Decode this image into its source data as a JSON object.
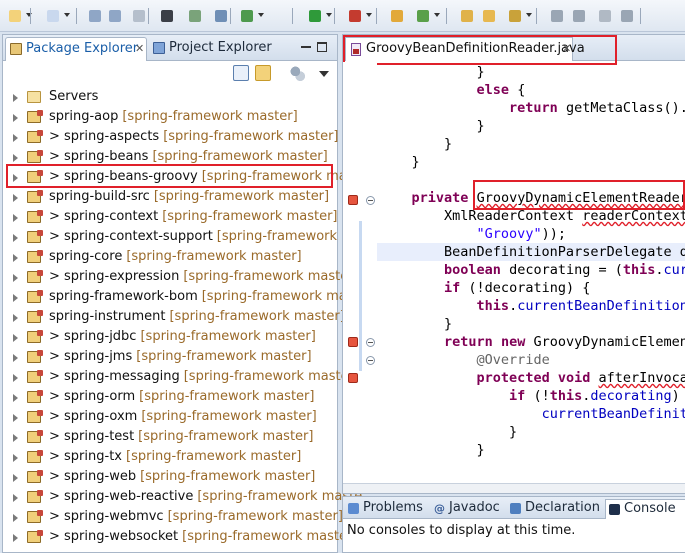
{
  "toolbar": {
    "buttons": [
      "new-icon",
      "new-wizard-icon",
      "save-icon",
      "save-all-icon",
      "print-icon",
      "console-icon",
      "open-type-icon",
      "refresh-icon",
      "run-debug-icon",
      "run-icon",
      "external-tools-icon",
      "new-java-project-icon",
      "new-class-icon",
      "open-folder-icon",
      "open-task-icon",
      "search-icon",
      "prev-annotation-icon",
      "next-annotation-icon",
      "toggle-mark-icon",
      "paragraph-icon"
    ]
  },
  "left_panel": {
    "tabs": [
      {
        "label": "Package Explorer",
        "active": true
      },
      {
        "label": "Project Explorer",
        "active": false
      }
    ],
    "tree": [
      {
        "name": "Servers",
        "repo": "",
        "prefix": "",
        "kind": "folder"
      },
      {
        "name": "spring-aop",
        "repo": "[spring-framework master]",
        "prefix": "",
        "kind": "project"
      },
      {
        "name": "spring-aspects",
        "repo": "[spring-framework master]",
        "prefix": "> ",
        "kind": "project"
      },
      {
        "name": "spring-beans",
        "repo": "[spring-framework master]",
        "prefix": "> ",
        "kind": "project"
      },
      {
        "name": "spring-beans-groovy",
        "repo": "[spring-framework mast",
        "prefix": "> ",
        "kind": "project"
      },
      {
        "name": "spring-build-src",
        "repo": "[spring-framework master]",
        "prefix": "",
        "kind": "project"
      },
      {
        "name": "spring-context",
        "repo": "[spring-framework master]",
        "prefix": "> ",
        "kind": "project"
      },
      {
        "name": "spring-context-support",
        "repo": "[spring-framework ma",
        "prefix": "> ",
        "kind": "project"
      },
      {
        "name": "spring-core",
        "repo": "[spring-framework master]",
        "prefix": "",
        "kind": "project"
      },
      {
        "name": "spring-expression",
        "repo": "[spring-framework master]",
        "prefix": "> ",
        "kind": "project"
      },
      {
        "name": "spring-framework-bom",
        "repo": "[spring-framework mast",
        "prefix": "",
        "kind": "project"
      },
      {
        "name": "spring-instrument",
        "repo": "[spring-framework master]",
        "prefix": "",
        "kind": "project"
      },
      {
        "name": "spring-jdbc",
        "repo": "[spring-framework master]",
        "prefix": "> ",
        "kind": "project"
      },
      {
        "name": "spring-jms",
        "repo": "[spring-framework master]",
        "prefix": "> ",
        "kind": "project"
      },
      {
        "name": "spring-messaging",
        "repo": "[spring-framework master]",
        "prefix": "> ",
        "kind": "project"
      },
      {
        "name": "spring-orm",
        "repo": "[spring-framework master]",
        "prefix": "> ",
        "kind": "project"
      },
      {
        "name": "spring-oxm",
        "repo": "[spring-framework master]",
        "prefix": "> ",
        "kind": "project"
      },
      {
        "name": "spring-test",
        "repo": "[spring-framework master]",
        "prefix": "> ",
        "kind": "project"
      },
      {
        "name": "spring-tx",
        "repo": "[spring-framework master]",
        "prefix": "> ",
        "kind": "project"
      },
      {
        "name": "spring-web",
        "repo": "[spring-framework master]",
        "prefix": "> ",
        "kind": "project"
      },
      {
        "name": "spring-web-reactive",
        "repo": "[spring-framework maste",
        "prefix": "> ",
        "kind": "project"
      },
      {
        "name": "spring-webmvc",
        "repo": "[spring-framework master]",
        "prefix": "> ",
        "kind": "project"
      },
      {
        "name": "spring-websocket",
        "repo": "[spring-framework master]",
        "prefix": "> ",
        "kind": "project"
      }
    ]
  },
  "editor": {
    "tab_label": "GroovyBeanDefinitionReader.java",
    "close_glyph": "✕",
    "code_lines": [
      "            }",
      "            else {",
      "                return getMetaClass().g",
      "            }",
      "        }",
      "    }",
      "",
      "    private GroovyDynamicElementReader",
      "        XmlReaderContext readerContext",
      "            \"Groovy\"));",
      "        BeanDefinitionParserDelegate de",
      "        boolean decorating = (this.curr",
      "        if (!decorating) {",
      "            this.currentBeanDefinition",
      "        }",
      "        return new GroovyDynamicElement",
      "            @Override",
      "            protected void afterInvocat",
      "                if (!this.decorating) {",
      "                    currentBeanDefiniti",
      "                }",
      "            }"
    ]
  },
  "console": {
    "tabs": [
      {
        "label": "Problems",
        "active": false,
        "icon": "problems-icon"
      },
      {
        "label": "Javadoc",
        "active": false,
        "icon": "javadoc-icon"
      },
      {
        "label": "Declaration",
        "active": false,
        "icon": "declaration-icon"
      },
      {
        "label": "Console",
        "active": true,
        "icon": "console-icon"
      }
    ],
    "message": "No consoles to display at this time."
  },
  "colors": {
    "highlight": "#e0202a",
    "keyword": "#7f0055",
    "field": "#0000c0",
    "string": "#2a00ff",
    "repo": "#9a6a2a"
  }
}
